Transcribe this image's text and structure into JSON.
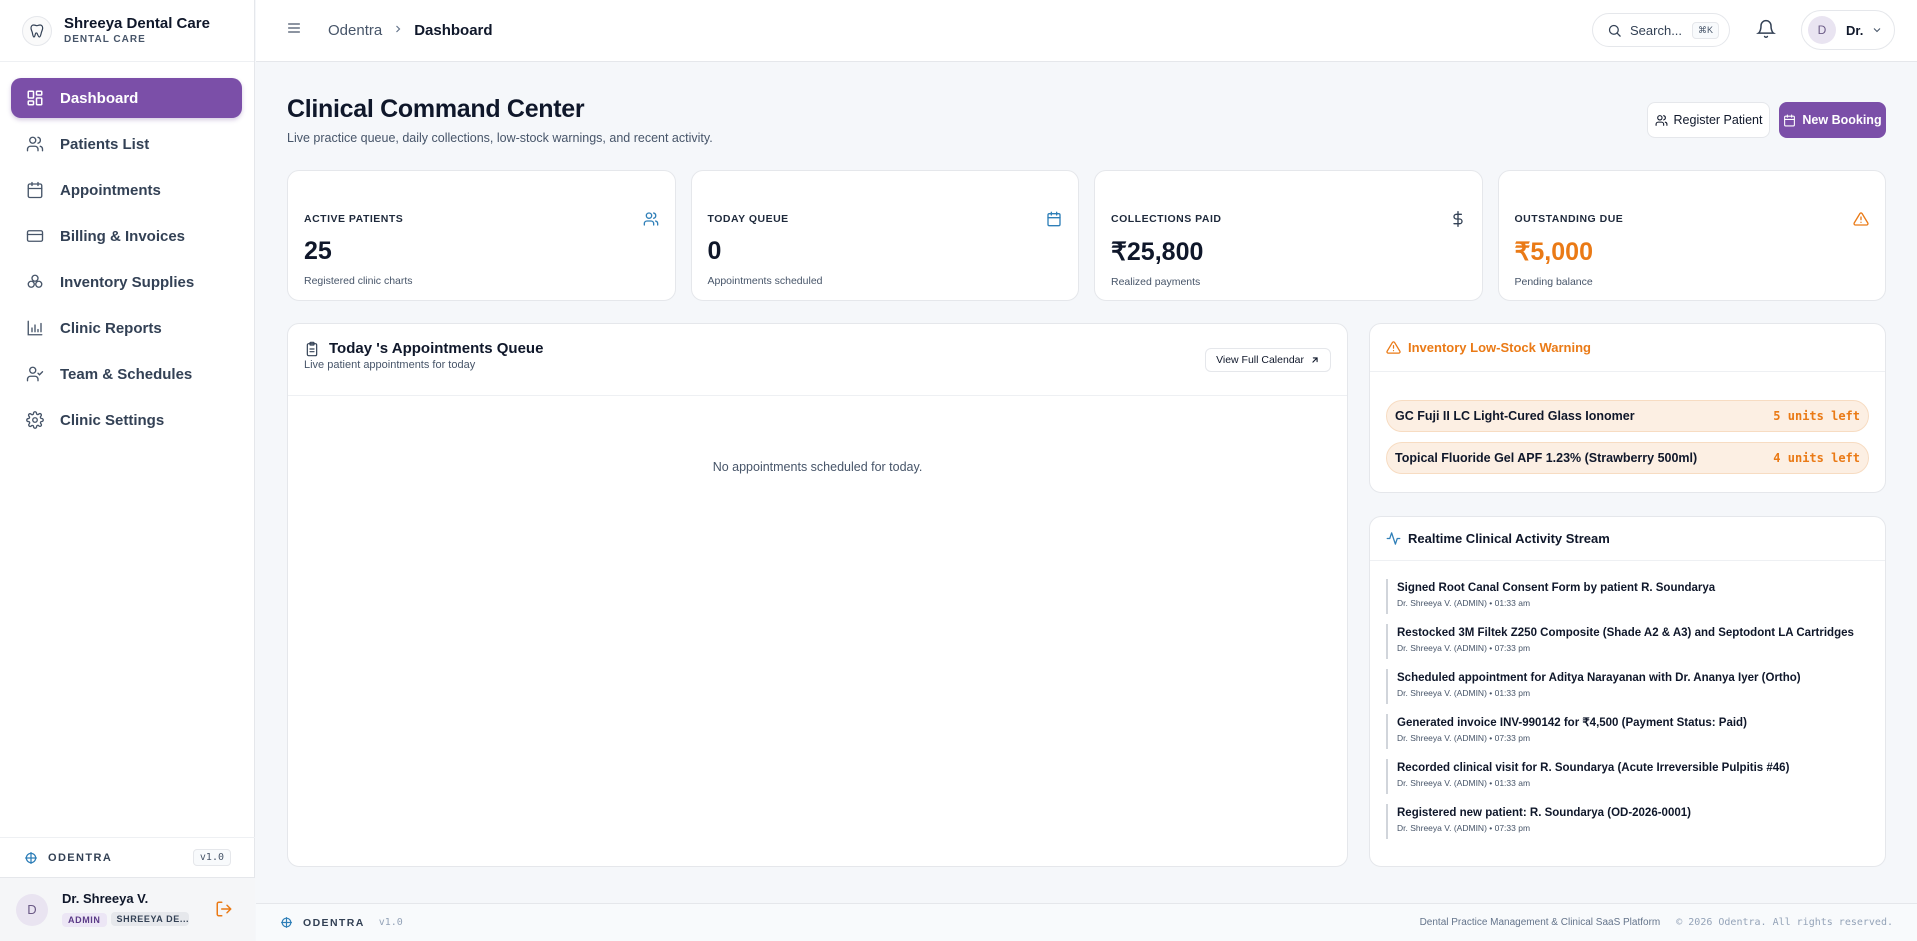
{
  "brand": {
    "name": "Shreeya Dental Care",
    "subtitle": "DENTAL CARE"
  },
  "sidebar": {
    "items": [
      {
        "label": "Dashboard",
        "icon": "dashboard-grid-icon",
        "active": true
      },
      {
        "label": "Patients List",
        "icon": "users-icon"
      },
      {
        "label": "Appointments",
        "icon": "calendar-icon"
      },
      {
        "label": "Billing & Invoices",
        "icon": "credit-card-icon"
      },
      {
        "label": "Inventory Supplies",
        "icon": "boxes-icon"
      },
      {
        "label": "Clinic Reports",
        "icon": "bar-chart-icon"
      },
      {
        "label": "Team & Schedules",
        "icon": "user-check-icon"
      },
      {
        "label": "Clinic Settings",
        "icon": "gear-icon"
      }
    ],
    "footer": {
      "product": "ODENTRA",
      "version": "v1.0"
    },
    "user": {
      "initial": "D",
      "name": "Dr. Shreeya V.",
      "role": "ADMIN",
      "clinic": "SHREEYA DE..."
    }
  },
  "topbar": {
    "breadcrumb_root": "Odentra",
    "breadcrumb_current": "Dashboard",
    "search_label": "Search...",
    "search_shortcut": "⌘K",
    "profile_initial": "D",
    "profile_name": "Dr."
  },
  "page": {
    "title": "Clinical Command Center",
    "subtitle": "Live practice queue, daily collections, low-stock warnings, and recent activity.",
    "register_label": "Register Patient",
    "booking_label": "New Booking"
  },
  "kpis": [
    {
      "label": "ACTIVE PATIENTS",
      "value": "25",
      "sub": "Registered clinic charts",
      "icon": "users-icon"
    },
    {
      "label": "TODAY QUEUE",
      "value": "0",
      "sub": "Appointments scheduled",
      "icon": "calendar-icon"
    },
    {
      "label": "COLLECTIONS PAID",
      "value": "₹25,800",
      "sub": "Realized payments",
      "icon": "dollar-icon"
    },
    {
      "label": "OUTSTANDING DUE",
      "value": "₹5,000",
      "sub": "Pending balance",
      "icon": "warning-icon"
    }
  ],
  "queue": {
    "title": "Today 's Appointments Queue",
    "subtitle": "Live patient appointments for today",
    "calendar_label": "View Full Calendar",
    "empty_text": "No appointments scheduled for today."
  },
  "stock": {
    "title": "Inventory Low-Stock Warning",
    "items": [
      {
        "name": "GC Fuji II LC Light-Cured Glass Ionomer",
        "qty": "5 units left"
      },
      {
        "name": "Topical Fluoride Gel APF 1.23% (Strawberry 500ml)",
        "qty": "4 units left"
      }
    ]
  },
  "activity": {
    "title": "Realtime Clinical Activity Stream",
    "items": [
      {
        "text": "Signed Root Canal Consent Form by patient R. Soundarya",
        "meta": "Dr. Shreeya V. (ADMIN) • 01:33 am"
      },
      {
        "text": "Restocked 3M Filtek Z250 Composite (Shade A2 & A3) and Septodont LA Cartridges",
        "meta": "Dr. Shreeya V. (ADMIN) • 07:33 pm"
      },
      {
        "text": "Scheduled appointment for Aditya Narayanan with Dr. Ananya Iyer (Ortho)",
        "meta": "Dr. Shreeya V. (ADMIN) • 01:33 pm"
      },
      {
        "text": "Generated invoice INV-990142 for ₹4,500 (Payment Status: Paid)",
        "meta": "Dr. Shreeya V. (ADMIN) • 07:33 pm"
      },
      {
        "text": "Recorded clinical visit for R. Soundarya (Acute Irreversible Pulpitis #46)",
        "meta": "Dr. Shreeya V. (ADMIN) • 01:33 am"
      },
      {
        "text": "Registered new patient: R. Soundarya (OD-2026-0001)",
        "meta": "Dr. Shreeya V. (ADMIN) • 07:33 pm"
      }
    ]
  },
  "footer": {
    "product": "ODENTRA",
    "version": "v1.0",
    "tagline": "Dental Practice Management & Clinical SaaS Platform",
    "copyright": "© 2026 Odentra. All rights reserved."
  },
  "colors": {
    "accent": "#7b4fa8",
    "warning": "#ea7a16",
    "info": "#2f7fb8"
  }
}
